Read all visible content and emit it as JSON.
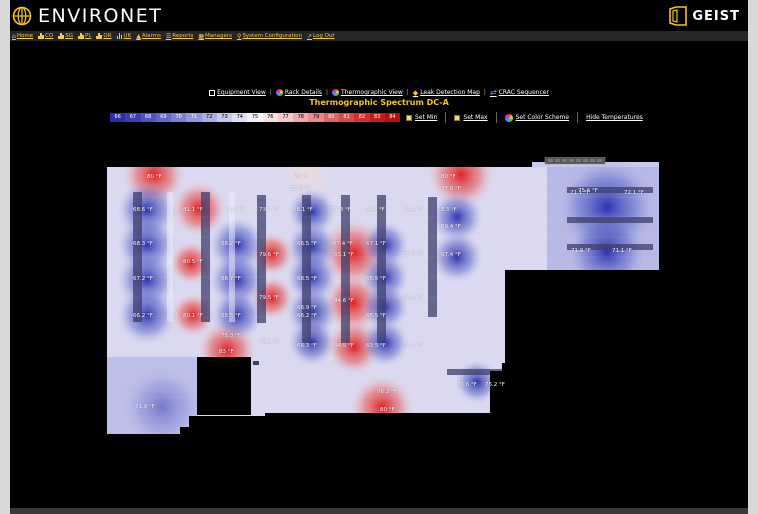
{
  "header": {
    "brand": "ENVIRONET",
    "vendor": "GEIST"
  },
  "nav": {
    "items": [
      {
        "label": "Home",
        "icon": "home-icon"
      },
      {
        "label": "CO",
        "icon": "bar-chart-icon"
      },
      {
        "label": "SG",
        "icon": "bar-chart-icon"
      },
      {
        "label": "PL",
        "icon": "bar-chart-icon"
      },
      {
        "label": "OR",
        "icon": "bar-chart-icon"
      },
      {
        "label": "UK",
        "icon": "bar-chart-icon"
      },
      {
        "label": "Alarms",
        "icon": "bell-icon"
      },
      {
        "label": "Reports",
        "icon": "reports-icon"
      },
      {
        "label": "Managers",
        "icon": "managers-icon"
      },
      {
        "label": "System Configuration",
        "icon": "wrench-icon"
      },
      {
        "label": "Log Out",
        "icon": "logout-icon"
      }
    ]
  },
  "subnav": {
    "equipment_view": "Equipment View",
    "rack_details": "Rack Details",
    "thermographic_view": "Thermographic View",
    "leak_detection_map": "Leak Detection Map",
    "crac_sequencer": "CRAC Sequencer"
  },
  "page_title": "Thermographic Spectrum DC-A",
  "scale": {
    "labels": [
      "66",
      "67",
      "68",
      "69",
      "70",
      "71",
      "72",
      "73",
      "74",
      "75",
      "76",
      "77",
      "78",
      "79",
      "80",
      "81",
      "82",
      "83",
      "84"
    ],
    "colors": [
      "#2b2fa8",
      "#3a40b4",
      "#4c54c0",
      "#6168cc",
      "#7880d6",
      "#9097de",
      "#aab0e6",
      "#c4c9ee",
      "#dde0f5",
      "#f3f3f7",
      "#f5e0e0",
      "#f2c8c8",
      "#eeaaaa",
      "#e88888",
      "#e06666",
      "#d84848",
      "#cf3030",
      "#c41c1c",
      "#b80e0e"
    ]
  },
  "controls": {
    "set_min": "Set Min",
    "set_max": "Set Max",
    "set_color_scheme": "Set Color Scheme",
    "hide_temperatures": "Hide Temperatures"
  },
  "temps": [
    {
      "t": "80 °F",
      "level": "hot"
    },
    {
      "t": "76 °F",
      "level": "mid"
    },
    {
      "t": "80 °F",
      "level": "hot"
    },
    {
      "t": "75.5 °F",
      "level": "mid"
    },
    {
      "t": "77.0 °F",
      "level": "mid"
    },
    {
      "t": "75.6 °F",
      "level": "mid"
    },
    {
      "t": "71.1 °F",
      "level": "cold"
    },
    {
      "t": "72.1 °F",
      "level": "cold"
    },
    {
      "t": "68.6 °F",
      "level": "cold"
    },
    {
      "t": "81.1 °F",
      "level": "hot"
    },
    {
      "t": "74.0 °F",
      "level": "mid"
    },
    {
      "t": "73.9 °F",
      "level": "mid"
    },
    {
      "t": "66.1 °F",
      "level": "cold"
    },
    {
      "t": "77.8 °F",
      "level": "hot"
    },
    {
      "t": "74.4 °F",
      "level": "mid"
    },
    {
      "t": "74.4 °F",
      "level": "mid"
    },
    {
      "t": "68.3 °F",
      "level": "cold"
    },
    {
      "t": "69.4 °F",
      "level": "cold"
    },
    {
      "t": "68.3 °F",
      "level": "cold"
    },
    {
      "t": "68.2 °F",
      "level": "cold"
    },
    {
      "t": "66.5 °F",
      "level": "cold"
    },
    {
      "t": "67.4 °F",
      "level": "cold"
    },
    {
      "t": "67.1 °F",
      "level": "cold"
    },
    {
      "t": "80.5 °F",
      "level": "hot"
    },
    {
      "t": "79.6 °F",
      "level": "hot"
    },
    {
      "t": "83.1 °F",
      "level": "hot"
    },
    {
      "t": "75.7 °F",
      "level": "mid"
    },
    {
      "t": "71.9 °F",
      "level": "cold"
    },
    {
      "t": "71.1 °F",
      "level": "cold"
    },
    {
      "t": "67.4 °F",
      "level": "cold"
    },
    {
      "t": "67.2 °F",
      "level": "cold"
    },
    {
      "t": "66.7 °F",
      "level": "cold"
    },
    {
      "t": "68.5 °F",
      "level": "cold"
    },
    {
      "t": "66.5 °F",
      "level": "cold"
    },
    {
      "t": "79.5 °F",
      "level": "hot"
    },
    {
      "t": "66.9 °F",
      "level": "cold"
    },
    {
      "t": "84.6 °F",
      "level": "hot"
    },
    {
      "t": "73.4 °F",
      "level": "mid"
    },
    {
      "t": "66.2 °F",
      "level": "cold"
    },
    {
      "t": "80.1 °F",
      "level": "hot"
    },
    {
      "t": "68.5 °F",
      "level": "cold"
    },
    {
      "t": "66.2 °F",
      "level": "cold"
    },
    {
      "t": "66.5 °F",
      "level": "cold"
    },
    {
      "t": "75.3 °F",
      "level": "mid"
    },
    {
      "t": "72.1 °F",
      "level": "cold"
    },
    {
      "t": "83 °F",
      "level": "hot"
    },
    {
      "t": "66.3 °F",
      "level": "cold"
    },
    {
      "t": "84.5 °F",
      "level": "hot"
    },
    {
      "t": "69.5 °F",
      "level": "cold"
    },
    {
      "t": "74.7 °F",
      "level": "mid"
    },
    {
      "t": "71.6 °F",
      "level": "cold"
    },
    {
      "t": "75.2 °F",
      "level": "mid"
    },
    {
      "t": "76.2 °F",
      "level": "mid"
    },
    {
      "t": "80 °F",
      "level": "hot"
    },
    {
      "t": "71.9 °F",
      "level": "cold"
    }
  ]
}
